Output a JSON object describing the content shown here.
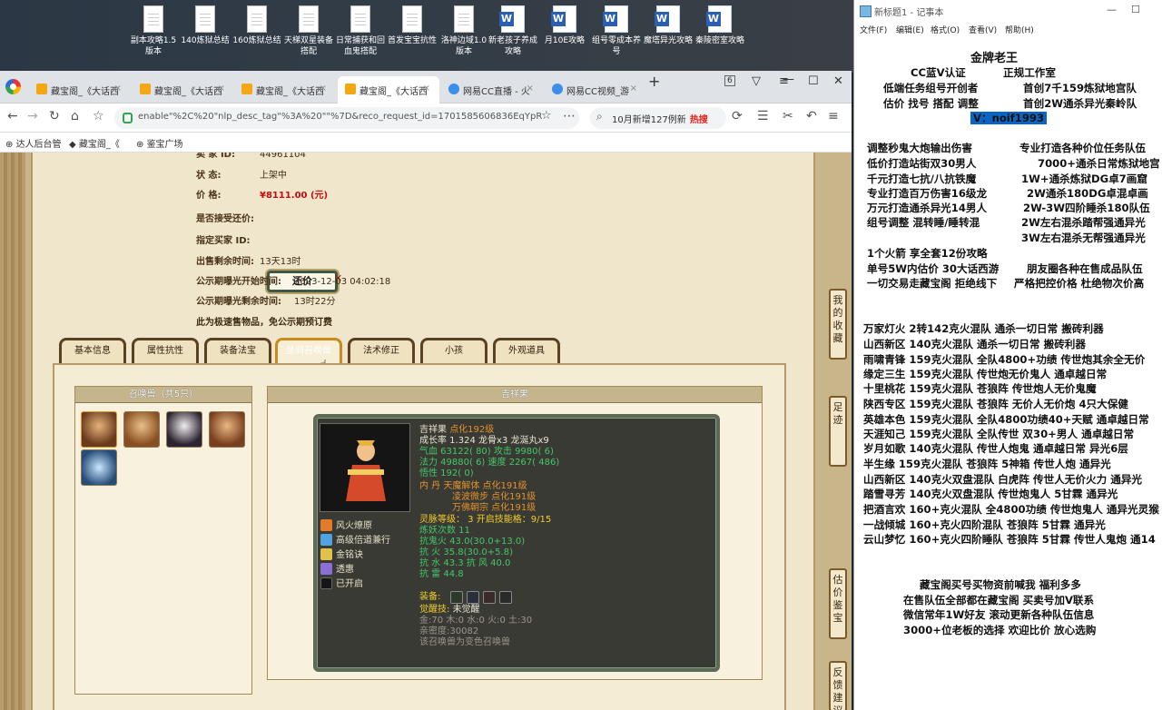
{
  "desktop": {
    "icons": [
      {
        "label": "副本攻略1.5版本",
        "type": "file"
      },
      {
        "label": "140炼狱总结",
        "type": "file"
      },
      {
        "label": "160炼狱总结",
        "type": "file"
      },
      {
        "label": "天梯双星装备搭配",
        "type": "file"
      },
      {
        "label": "日常捕获和回血鬼搭配",
        "type": "file"
      },
      {
        "label": "首发宝宝抗性",
        "type": "file"
      },
      {
        "label": "洛神边域1.0版本",
        "type": "file"
      },
      {
        "label": "新老孩子养成攻略",
        "type": "word"
      },
      {
        "label": "月10E攻略",
        "type": "word"
      },
      {
        "label": "组号零成本养号",
        "type": "word"
      },
      {
        "label": "魔塔异光攻略",
        "type": "word"
      },
      {
        "label": "秦陵密室攻略",
        "type": "word"
      }
    ]
  },
  "browser": {
    "tabs": [
      "藏宝阁_《大话西",
      "藏宝阁_《大话西",
      "藏宝阁_《大话西",
      "藏宝阁_《大话西",
      "网易CC直播 - 火",
      "网易CC视频_游"
    ],
    "tab_count": "6",
    "url": "enable\"%2C%20\"nlp_desc_tag\"%3A%20\"\"%7D&reco_request_id=1701585606836EqYpR",
    "search_text": "10月新增127例新",
    "search_hot": "热搜",
    "bookmarks": [
      "达人后台管",
      "藏宝阁_《",
      "鉴宝广场"
    ]
  },
  "listing": {
    "seller_label": "卖 家 ID:",
    "seller_id": "44961104",
    "status_label": "状 态:",
    "status": "上架中",
    "price_label": "价 格:",
    "price": "¥8111.00 (元)",
    "bargain_label": "是否接受还价:",
    "bargain_button": "还价",
    "buyer_label": "指定买家 ID:",
    "remaining_label": "出售剩余时间:",
    "remaining": "13天13时",
    "public_start_label": "公示期曝光开始时间:",
    "public_start": "2023-12-03 04:02:18",
    "public_remaining_label": "公示期曝光剩余时间:",
    "public_remaining": "13时22分",
    "note": "此为极速售物品，免公示期预订费"
  },
  "game_tabs": [
    "基本信息",
    "属性抗性",
    "装备法宝",
    "坐骑召唤兽",
    "法术修正",
    "小孩",
    "外观道具"
  ],
  "pets": {
    "header": "召唤兽（共5只）",
    "detail_header": "吉祥果"
  },
  "pet": {
    "name": "吉祥果",
    "dot": "点化192级",
    "growth": "成长率 1.324 龙骨x3 龙涎丸x9",
    "hp": "气血 63122( 80)",
    "atk": "攻击 9980( 6)",
    "mp": "法力 49880( 6)",
    "spd": "速度 2267( 486)",
    "wx": "悟性 192( 0)",
    "inner1": "内  丹 天魔解体 点化191级",
    "inner2": "凌波微步 点化191级",
    "inner3": "万佛朝宗 点化191级",
    "spirit": "灵脉等级： 3 开启技能格：9/15",
    "yao": "炼妖次数 11",
    "r1": "抗鬼火 43.0(30.0+13.0)",
    "r2": "抗   火 35.8(30.0+5.8)",
    "r3": "抗   水 43.3 抗   风 40.0",
    "r4": "抗   雷 44.8",
    "equip": "装备:",
    "awake_label": "觉醒技:",
    "awake": "未觉醒",
    "elements": "金:70 木:0 水:0 火:0 土:30",
    "intimacy": "亲密度:30082",
    "note": "该召唤兽为变色召唤兽",
    "skills": [
      "风火燎原",
      "高级倍道兼行",
      "金铭诀",
      "透惠",
      "已开启"
    ]
  },
  "right_strip": [
    "我的收藏",
    "足迹",
    "估价鉴宝",
    "反馈建议"
  ],
  "notepad": {
    "title": "新标题1 - 记事本",
    "menu": [
      "文件(F)",
      "编辑(E)",
      "格式(O)",
      "查看(V)",
      "帮助(H)"
    ],
    "lines": [
      "金牌老王",
      "CC蓝V认证",
      "正规工作室",
      "低端任务组号开创者",
      "首创7千159炼狱地宫队",
      "估价 找号 搭配 调整",
      "首创2W通杀异光秦岭队",
      "V：noif1993",
      "调整秒鬼大炮输出伤害",
      "专业打造各种价位任务队伍",
      "低价打造站街双30男人",
      "7000+通杀日常炼狱地宫",
      "千元打造七抗/八抗铁魔",
      "1W+通杀炼狱DG卓7画窟",
      "专业打造百万伤害16级龙",
      "2W通杀180DG卓混卓画",
      "万元打造通杀异光14男人",
      "2W-3W四阶睡杀180队伍",
      "组号调整 混转睡/睡转混",
      "2W左右混杀踏帮强通异光",
      "3W左右混杀无帮强通异光",
      "1个火箭 享全套12份攻略",
      "单号5W内估价 30大话西游",
      "朋友圈各种在售成品队伍",
      "一切交易走藏宝阁 拒绝线下",
      "严格把控价格 杜绝物次价高",
      "万家灯火 2转142克火混队 通杀一切日常 搬砖利器",
      "山西新区 140克火混队 通杀一切日常 搬砖利器",
      "雨啸青锋 159克火混队 全队4800+功绩 传世炮其余全无价",
      "缘定三生 159克火混队 传世炮无价鬼人 通卓越日常",
      "十里桃花 159克火混队 苍狼阵 传世炮人无价鬼魔",
      "陕西专区 159克火混队 苍狼阵 无价人无价炮 4只大保健",
      "英雄本色 159克火混队 全队4800功绩40+天赋 通卓越日常",
      "天涯知己 159克火混队 全队传世 双30+男人 通卓越日常",
      "岁月如歌 140克火混队 传世人炮鬼 通卓越日常 异光6层",
      "半生缘 159克火混队 苍狼阵 5神箱 传世人炮 通异光",
      "山西新区 140克火双盘混队 白虎阵 传世人无价火力 通异光",
      "踏雪寻芳 140克火双盘混队 传世炮鬼人 5甘霖 通异光",
      "把酒言欢 160+克火混队 全4800功绩 传世炮鬼人 通异光灵猴",
      "一战倾城 160+克火四阶混队 苍狼阵 5甘霖 通异光",
      "云山梦忆 160+克火四阶睡队 苍狼阵 5甘霖 传世人鬼炮 通14",
      "藏宝阁买号买物资前喊我 福利多多",
      "在售队伍全部都在藏宝阁 买卖号加V联系",
      "微信常年1W好友 滚动更新各种队伍信息",
      "3000+位老板的选择 欢迎比价 放心选购"
    ]
  }
}
